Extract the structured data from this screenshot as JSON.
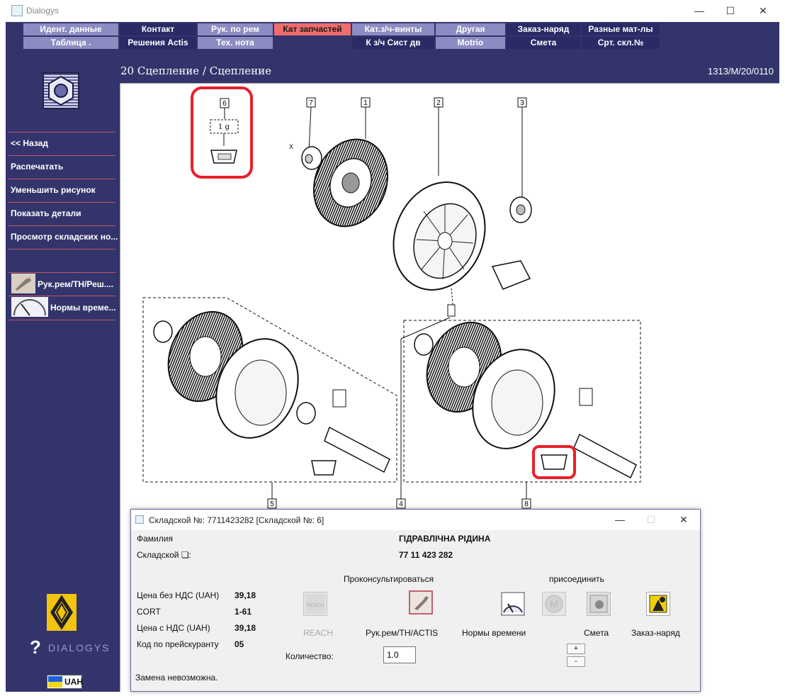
{
  "window": {
    "title": "Dialogys",
    "controls": {
      "minimize": "—",
      "maximize": "☐",
      "close": "✕"
    }
  },
  "menu": {
    "row1": [
      "Идент. данные",
      "Контакт",
      "Рук. по рем",
      "Кат запчастей",
      "Кат.з/ч-винты",
      "Другая",
      "Заказ-наряд",
      "Разные мат-лы"
    ],
    "row2": [
      "Таблица .",
      "Решения Actis",
      "Тех. нота",
      "",
      "К з/ч Сист дв",
      "Motrio",
      "Смета",
      "Срт. скл.№"
    ]
  },
  "sidebar": {
    "items": [
      "<< Назад",
      "Распечатать",
      "Уменьшить рисунок",
      "Показать детали",
      "Просмотр складских но..."
    ],
    "tools": [
      "Рук.рем/ТН/Реш....",
      "Нормы време..."
    ],
    "brand": "DIALOGYS",
    "currency": "UAH"
  },
  "content": {
    "title": "20 Сцепление / Сцепление",
    "ref": "1313/M/20/0110"
  },
  "diagram": {
    "callouts": [
      "6",
      "7",
      "1",
      "2",
      "3",
      "5",
      "4",
      "8"
    ],
    "qty_label": "1 g",
    "dim_label": "X"
  },
  "dialog": {
    "title": "Складской №: 7711423282 [Складской №: 6]",
    "controls": {
      "minimize": "—",
      "maximize": "☐",
      "close": "✕"
    },
    "family_label": "Фамилия",
    "family_value": "ГІДРАВЛІЧНА РІДИНА",
    "stock_label": "Складской ❏:",
    "stock_value": "77 11 423 282",
    "consult_label": "Проконсультироваться",
    "attach_label": "присоединить",
    "prices": [
      {
        "label": "Цена без НДС (UAH)",
        "value": "39,18"
      },
      {
        "label": "CORT",
        "value": "1-61"
      },
      {
        "label": "Цена с НДС (UAH)",
        "value": "39,18"
      },
      {
        "label": "Код по прейскуранту",
        "value": "05"
      }
    ],
    "captions": {
      "reach": "REACH",
      "manual": "Рук.рем/ТН/ACTIS",
      "norms": "Нормы времени",
      "estimate": "Смета",
      "order": "Заказ-наряд"
    },
    "qty_label": "Количество:",
    "qty_value": "1.0",
    "plus": "+",
    "minus": "-",
    "status": "Замена невозможна."
  },
  "colors": {
    "frame": "#34346c",
    "tab_light": "#8c8cc2",
    "tab_dark": "#2a2a66",
    "tab_active": "#ee6d6d",
    "highlight": "#e8202a",
    "divider": "#c65462"
  }
}
